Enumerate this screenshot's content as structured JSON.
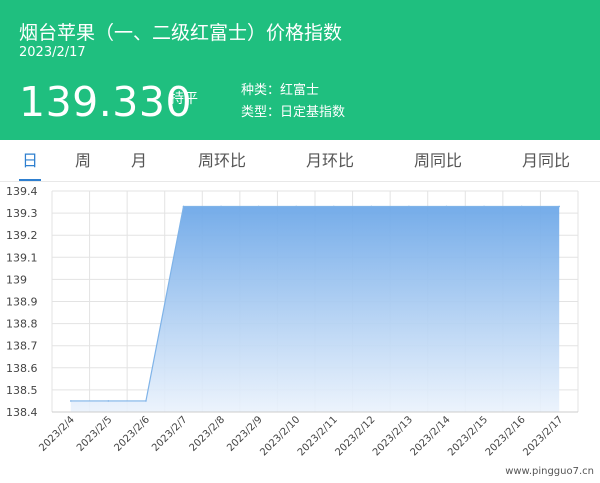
{
  "header": {
    "title": "烟台苹果（一、二级红富士）价格指数",
    "date": "2023/2/17",
    "price": "139.330",
    "trend": "持平",
    "variety": "种类：红富士",
    "type": "类型：日定基指数",
    "bg_color": "#1fbf7f"
  },
  "tabs": [
    {
      "label": "日",
      "active": true
    },
    {
      "label": "周",
      "active": false
    },
    {
      "label": "月",
      "active": false
    },
    {
      "label": "周环比",
      "active": false
    },
    {
      "label": "月环比",
      "active": false
    },
    {
      "label": "周同比",
      "active": false
    },
    {
      "label": "月同比",
      "active": false
    }
  ],
  "watermark": "www.pingguo7.cn",
  "chart_data": {
    "type": "area",
    "x": [
      "2023/2/4",
      "2023/2/5",
      "2023/2/6",
      "2023/2/7",
      "2023/2/8",
      "2023/2/9",
      "2023/2/10",
      "2023/2/11",
      "2023/2/12",
      "2023/2/13",
      "2023/2/14",
      "2023/2/15",
      "2023/2/16",
      "2023/2/17"
    ],
    "values": [
      138.45,
      138.45,
      138.45,
      139.33,
      139.33,
      139.33,
      139.33,
      139.33,
      139.33,
      139.33,
      139.33,
      139.33,
      139.33,
      139.33
    ],
    "yticks": [
      "138.4",
      "138.5",
      "138.6",
      "138.7",
      "138.8",
      "138.9",
      "139",
      "139.1",
      "139.2",
      "139.3",
      "139.4"
    ],
    "ylim": [
      138.4,
      139.4
    ],
    "grid": true,
    "line_color": "#7fb3e8",
    "fill_top_color": "#6ea8e8",
    "fill_bottom_color": "#eaf2fc"
  }
}
